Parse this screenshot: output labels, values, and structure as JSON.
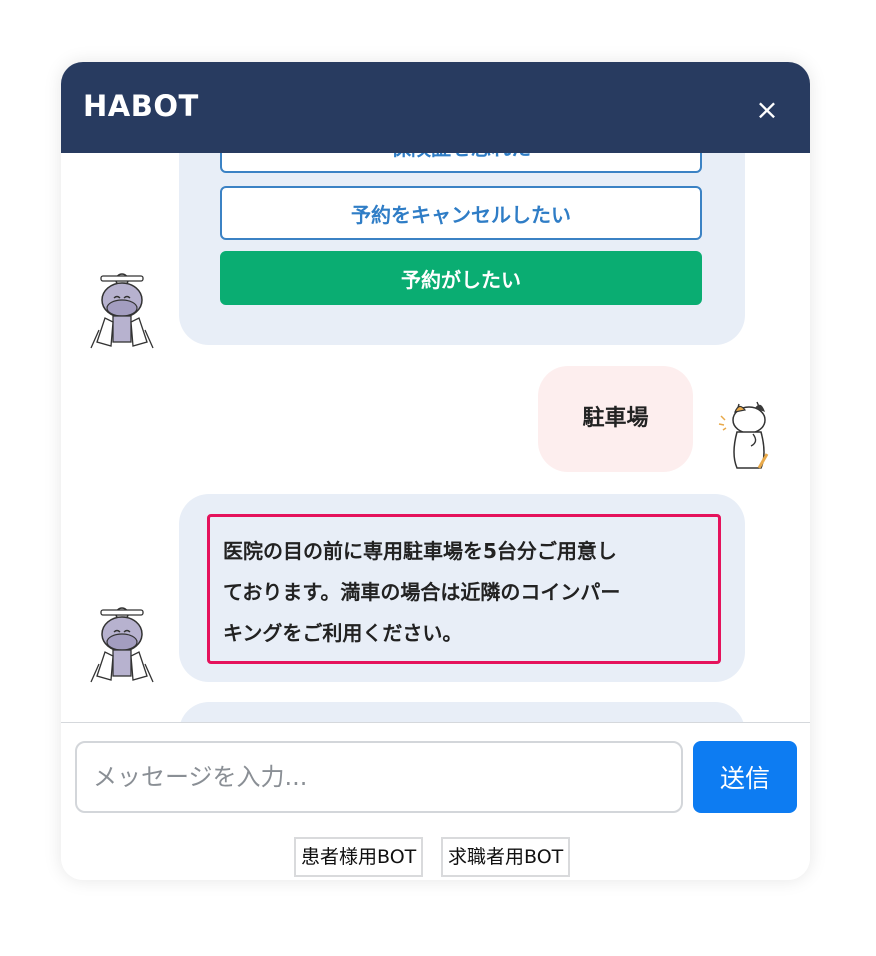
{
  "header": {
    "title": "HABOT",
    "close_label": "×"
  },
  "chat": {
    "partial_option_label": "保険証を忘れた",
    "options": [
      {
        "label": "予約をキャンセルしたい",
        "style": "outline"
      },
      {
        "label": "予約がしたい",
        "style": "primary"
      }
    ],
    "user_message": "駐車場",
    "bot_answer_lines": [
      "医院の目の前に専用駐車場を5台分ご用意し",
      "ております。満車の場合は近隣のコインパー",
      "キングをご利用ください。"
    ],
    "bot_avatar_icon": "hippo-doctor-icon",
    "user_avatar_icon": "cat-user-icon"
  },
  "input": {
    "placeholder": "メッセージを入力...",
    "value": ""
  },
  "send_label": "送信",
  "bot_switch": [
    {
      "label": "患者様用BOT"
    },
    {
      "label": "求職者用BOT"
    }
  ],
  "colors": {
    "header": "#283b60",
    "option_border": "#3b82c4",
    "primary_option": "#0aad72",
    "bot_bubble": "#e8eef7",
    "user_bubble": "#fdeeee",
    "highlight": "#e5125c",
    "send": "#0d7cf2"
  }
}
